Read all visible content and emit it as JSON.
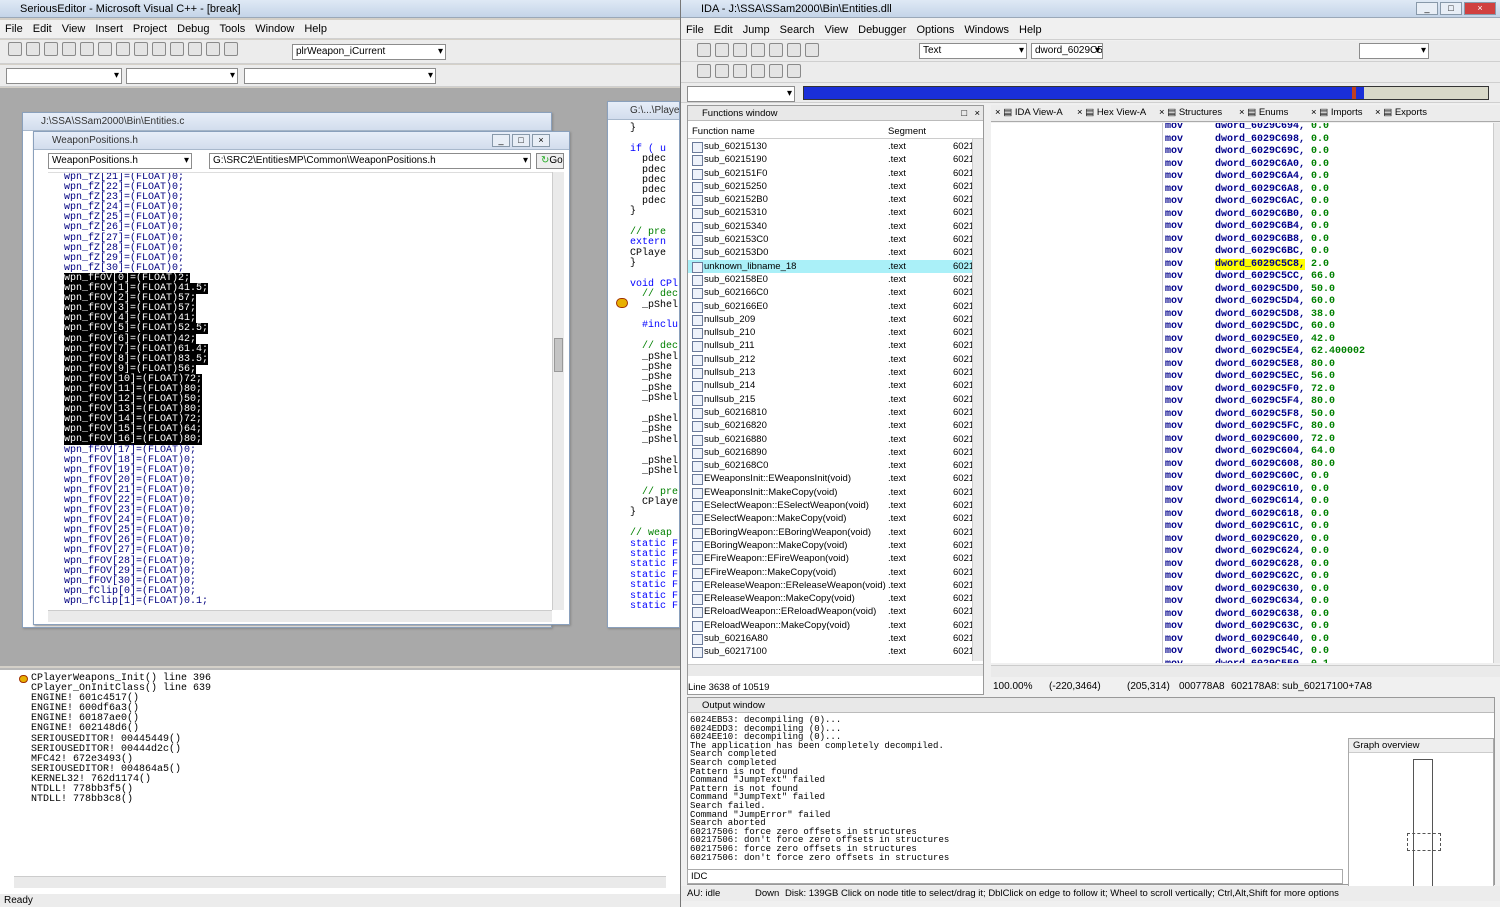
{
  "se": {
    "title": "SeriousEditor - Microsoft Visual C++ - [break]",
    "menu": [
      "File",
      "Edit",
      "View",
      "Insert",
      "Project",
      "Debug",
      "Tools",
      "Window",
      "Help"
    ],
    "combo_func": "plrWeapon_iCurrent",
    "win_entities_title": "J:\\SSA\\SSam2000\\Bin\\Entities.c",
    "win_wp_title": "WeaponPositions.h",
    "wp_combo_file": "WeaponPositions.h",
    "wp_combo_path": "G:\\SRC2\\EntitiesMP\\Common\\WeaponPositions.h",
    "go_label": "Go",
    "code_lines": [
      {
        "t": "wpn_fZ[21]=(FLOAT)0;",
        "s": false
      },
      {
        "t": "wpn_fZ[22]=(FLOAT)0;",
        "s": false
      },
      {
        "t": "wpn_fZ[23]=(FLOAT)0;",
        "s": false
      },
      {
        "t": "wpn_fZ[24]=(FLOAT)0;",
        "s": false
      },
      {
        "t": "wpn_fZ[25]=(FLOAT)0;",
        "s": false
      },
      {
        "t": "wpn_fZ[26]=(FLOAT)0;",
        "s": false
      },
      {
        "t": "wpn_fZ[27]=(FLOAT)0;",
        "s": false
      },
      {
        "t": "wpn_fZ[28]=(FLOAT)0;",
        "s": false
      },
      {
        "t": "wpn_fZ[29]=(FLOAT)0;",
        "s": false
      },
      {
        "t": "wpn_fZ[30]=(FLOAT)0;",
        "s": false
      },
      {
        "t": "wpn_fFOV[0]=(FLOAT)2;",
        "s": true
      },
      {
        "t": "wpn_fFOV[1]=(FLOAT)41.5;",
        "s": true
      },
      {
        "t": "wpn_fFOV[2]=(FLOAT)57;",
        "s": true
      },
      {
        "t": "wpn_fFOV[3]=(FLOAT)57;",
        "s": true
      },
      {
        "t": "wpn_fFOV[4]=(FLOAT)41;",
        "s": true
      },
      {
        "t": "wpn_fFOV[5]=(FLOAT)52.5;",
        "s": true
      },
      {
        "t": "wpn_fFOV[6]=(FLOAT)42;",
        "s": true
      },
      {
        "t": "wpn_fFOV[7]=(FLOAT)61.4;",
        "s": true
      },
      {
        "t": "wpn_fFOV[8]=(FLOAT)83.5;",
        "s": true
      },
      {
        "t": "wpn_fFOV[9]=(FLOAT)56;",
        "s": true
      },
      {
        "t": "wpn_fFOV[10]=(FLOAT)72;",
        "s": true
      },
      {
        "t": "wpn_fFOV[11]=(FLOAT)80;",
        "s": true
      },
      {
        "t": "wpn_fFOV[12]=(FLOAT)50;",
        "s": true
      },
      {
        "t": "wpn_fFOV[13]=(FLOAT)80;",
        "s": true
      },
      {
        "t": "wpn_fFOV[14]=(FLOAT)72;",
        "s": true
      },
      {
        "t": "wpn_fFOV[15]=(FLOAT)64;",
        "s": true
      },
      {
        "t": "wpn_fFOV[16]=(FLOAT)80;",
        "s": true
      },
      {
        "t": "wpn_fFOV[17]=(FLOAT)0;",
        "s": false
      },
      {
        "t": "wpn_fFOV[18]=(FLOAT)0;",
        "s": false
      },
      {
        "t": "wpn_fFOV[19]=(FLOAT)0;",
        "s": false
      },
      {
        "t": "wpn_fFOV[20]=(FLOAT)0;",
        "s": false
      },
      {
        "t": "wpn_fFOV[21]=(FLOAT)0;",
        "s": false
      },
      {
        "t": "wpn_fFOV[22]=(FLOAT)0;",
        "s": false
      },
      {
        "t": "wpn_fFOV[23]=(FLOAT)0;",
        "s": false
      },
      {
        "t": "wpn_fFOV[24]=(FLOAT)0;",
        "s": false
      },
      {
        "t": "wpn_fFOV[25]=(FLOAT)0;",
        "s": false
      },
      {
        "t": "wpn_fFOV[26]=(FLOAT)0;",
        "s": false
      },
      {
        "t": "wpn_fFOV[27]=(FLOAT)0;",
        "s": false
      },
      {
        "t": "wpn_fFOV[28]=(FLOAT)0;",
        "s": false
      },
      {
        "t": "wpn_fFOV[29]=(FLOAT)0;",
        "s": false
      },
      {
        "t": "wpn_fFOV[30]=(FLOAT)0;",
        "s": false
      },
      {
        "t": "wpn_fClip[0]=(FLOAT)0;",
        "s": false
      },
      {
        "t": "wpn_fClip[1]=(FLOAT)0.1;",
        "s": false
      }
    ],
    "win_player_title": "G:\\...\\Player",
    "player_lines": [
      "}",
      "",
      "if ( u",
      "  pdec",
      "  pdec",
      "  pdec",
      "  pdec",
      "  pdec",
      "}",
      "",
      "// pre",
      "extern",
      "CPlaye",
      "}",
      "",
      "void CPl",
      "  // dec",
      "  _pShel",
      "",
      "  #inclu",
      "",
      "  // dec",
      "  _pShel",
      "  _pShe",
      "  _pShe",
      "  _pShe",
      "  _pShel",
      "",
      "  _pShel",
      "  _pShe",
      "  _pShel",
      "",
      "  _pShel",
      "  _pShel",
      "",
      "  // pre",
      "  CPlaye",
      "}",
      "",
      "// weap",
      "static F",
      "static F",
      "static F",
      "static F",
      "static F",
      "static F",
      "static F"
    ],
    "callstack": [
      "CPlayerWeapons_Init() line 396",
      "CPlayer_OnInitClass() line 639",
      "ENGINE! 601c4517()",
      "ENGINE! 600df6a3()",
      "ENGINE! 60187ae0()",
      "ENGINE! 602148d6()",
      "SERIOUSEDITOR! 00445449()",
      "SERIOUSEDITOR! 00444d2c()",
      "MFC42! 672e3493()",
      "SERIOUSEDITOR! 004864a5()",
      "KERNEL32! 762d1174()",
      "NTDLL! 778bb3f5()",
      "NTDLL! 778bb3c8()"
    ],
    "status": "Ready"
  },
  "ida": {
    "title": "IDA - J:\\SSA\\SSam2000\\Bin\\Entities.dll",
    "menu": [
      "File",
      "Edit",
      "Jump",
      "Search",
      "View",
      "Debugger",
      "Options",
      "Windows",
      "Help"
    ],
    "combo_text": "Text",
    "combo_dword": "dword_6029C5",
    "fw_title": "Functions window",
    "col_name": "Function name",
    "col_segment": "Segment",
    "functions": [
      {
        "n": "sub_60215130",
        "s": ".text",
        "a": "6021"
      },
      {
        "n": "sub_60215190",
        "s": ".text",
        "a": "6021"
      },
      {
        "n": "sub_602151F0",
        "s": ".text",
        "a": "6021"
      },
      {
        "n": "sub_60215250",
        "s": ".text",
        "a": "6021"
      },
      {
        "n": "sub_602152B0",
        "s": ".text",
        "a": "6021"
      },
      {
        "n": "sub_60215310",
        "s": ".text",
        "a": "6021"
      },
      {
        "n": "sub_60215340",
        "s": ".text",
        "a": "6021"
      },
      {
        "n": "sub_602153C0",
        "s": ".text",
        "a": "6021"
      },
      {
        "n": "sub_602153D0",
        "s": ".text",
        "a": "6021"
      },
      {
        "n": "unknown_libname_18",
        "s": ".text",
        "a": "6021",
        "h": true
      },
      {
        "n": "sub_602158E0",
        "s": ".text",
        "a": "6021"
      },
      {
        "n": "sub_602166C0",
        "s": ".text",
        "a": "6021"
      },
      {
        "n": "sub_602166E0",
        "s": ".text",
        "a": "6021"
      },
      {
        "n": "nullsub_209",
        "s": ".text",
        "a": "6021"
      },
      {
        "n": "nullsub_210",
        "s": ".text",
        "a": "6021"
      },
      {
        "n": "nullsub_211",
        "s": ".text",
        "a": "6021"
      },
      {
        "n": "nullsub_212",
        "s": ".text",
        "a": "6021"
      },
      {
        "n": "nullsub_213",
        "s": ".text",
        "a": "6021"
      },
      {
        "n": "nullsub_214",
        "s": ".text",
        "a": "6021"
      },
      {
        "n": "nullsub_215",
        "s": ".text",
        "a": "6021"
      },
      {
        "n": "sub_60216810",
        "s": ".text",
        "a": "6021"
      },
      {
        "n": "sub_60216820",
        "s": ".text",
        "a": "6021"
      },
      {
        "n": "sub_60216880",
        "s": ".text",
        "a": "6021"
      },
      {
        "n": "sub_60216890",
        "s": ".text",
        "a": "6021"
      },
      {
        "n": "sub_602168C0",
        "s": ".text",
        "a": "6021"
      },
      {
        "n": "EWeaponsInit::EWeaponsInit(void)",
        "s": ".text",
        "a": "6021"
      },
      {
        "n": "EWeaponsInit::MakeCopy(void)",
        "s": ".text",
        "a": "6021"
      },
      {
        "n": "ESelectWeapon::ESelectWeapon(void)",
        "s": ".text",
        "a": "6021"
      },
      {
        "n": "ESelectWeapon::MakeCopy(void)",
        "s": ".text",
        "a": "6021"
      },
      {
        "n": "EBoringWeapon::EBoringWeapon(void)",
        "s": ".text",
        "a": "6021"
      },
      {
        "n": "EBoringWeapon::MakeCopy(void)",
        "s": ".text",
        "a": "6021"
      },
      {
        "n": "EFireWeapon::EFireWeapon(void)",
        "s": ".text",
        "a": "6021"
      },
      {
        "n": "EFireWeapon::MakeCopy(void)",
        "s": ".text",
        "a": "6021"
      },
      {
        "n": "EReleaseWeapon::EReleaseWeapon(void)",
        "s": ".text",
        "a": "6021"
      },
      {
        "n": "EReleaseWeapon::MakeCopy(void)",
        "s": ".text",
        "a": "6021"
      },
      {
        "n": "EReloadWeapon::EReloadWeapon(void)",
        "s": ".text",
        "a": "6021"
      },
      {
        "n": "EReloadWeapon::MakeCopy(void)",
        "s": ".text",
        "a": "6021"
      },
      {
        "n": "sub_60216A80",
        "s": ".text",
        "a": "6021"
      },
      {
        "n": "sub_60217100",
        "s": ".text",
        "a": "6021"
      }
    ],
    "fw_status": "Line 3638 of 10519",
    "tabs": [
      "IDA View-A",
      "Hex View-A",
      "Structures",
      "Enums",
      "Imports",
      "Exports"
    ],
    "asm": [
      [
        "mov",
        "dword_6029C694,",
        "0.0"
      ],
      [
        "mov",
        "dword_6029C698,",
        "0.0"
      ],
      [
        "mov",
        "dword_6029C69C,",
        "0.0"
      ],
      [
        "mov",
        "dword_6029C6A0,",
        "0.0"
      ],
      [
        "mov",
        "dword_6029C6A4,",
        "0.0"
      ],
      [
        "mov",
        "dword_6029C6A8,",
        "0.0"
      ],
      [
        "mov",
        "dword_6029C6AC,",
        "0.0"
      ],
      [
        "mov",
        "dword_6029C6B0,",
        "0.0"
      ],
      [
        "mov",
        "dword_6029C6B4,",
        "0.0"
      ],
      [
        "mov",
        "dword_6029C6B8,",
        "0.0"
      ],
      [
        "mov",
        "dword_6029C6BC,",
        "0.0"
      ],
      [
        "mov",
        "dword_6029C5C8,",
        "2.0"
      ],
      [
        "mov",
        "dword_6029C5CC,",
        "66.0"
      ],
      [
        "mov",
        "dword_6029C5D0,",
        "50.0"
      ],
      [
        "mov",
        "dword_6029C5D4,",
        "60.0"
      ],
      [
        "mov",
        "dword_6029C5D8,",
        "38.0"
      ],
      [
        "mov",
        "dword_6029C5DC,",
        "60.0"
      ],
      [
        "mov",
        "dword_6029C5E0,",
        "42.0"
      ],
      [
        "mov",
        "dword_6029C5E4,",
        "62.400002"
      ],
      [
        "mov",
        "dword_6029C5E8,",
        "80.0"
      ],
      [
        "mov",
        "dword_6029C5EC,",
        "56.0"
      ],
      [
        "mov",
        "dword_6029C5F0,",
        "72.0"
      ],
      [
        "mov",
        "dword_6029C5F4,",
        "80.0"
      ],
      [
        "mov",
        "dword_6029C5F8,",
        "50.0"
      ],
      [
        "mov",
        "dword_6029C5FC,",
        "80.0"
      ],
      [
        "mov",
        "dword_6029C600,",
        "72.0"
      ],
      [
        "mov",
        "dword_6029C604,",
        "64.0"
      ],
      [
        "mov",
        "dword_6029C608,",
        "80.0"
      ],
      [
        "mov",
        "dword_6029C60C,",
        "0.0"
      ],
      [
        "mov",
        "dword_6029C610,",
        "0.0"
      ],
      [
        "mov",
        "dword_6029C614,",
        "0.0"
      ],
      [
        "mov",
        "dword_6029C618,",
        "0.0"
      ],
      [
        "mov",
        "dword_6029C61C,",
        "0.0"
      ],
      [
        "mov",
        "dword_6029C620,",
        "0.0"
      ],
      [
        "mov",
        "dword_6029C624,",
        "0.0"
      ],
      [
        "mov",
        "dword_6029C628,",
        "0.0"
      ],
      [
        "mov",
        "dword_6029C62C,",
        "0.0"
      ],
      [
        "mov",
        "dword_6029C630,",
        "0.0"
      ],
      [
        "mov",
        "dword_6029C634,",
        "0.0"
      ],
      [
        "mov",
        "dword_6029C638,",
        "0.0"
      ],
      [
        "mov",
        "dword_6029C63C,",
        "0.0"
      ],
      [
        "mov",
        "dword_6029C640,",
        "0.0"
      ],
      [
        "mov",
        "dword_6029C54C,",
        "0.0"
      ],
      [
        "mov",
        "dword_6029C550,",
        "0.1"
      ]
    ],
    "view_status": [
      "100.00%",
      "(-220,3464)",
      "(205,314)",
      "000778A8",
      "602178A8: sub_60217100+7A8"
    ],
    "output_title": "Output window",
    "output": [
      "6024EB53: decompiling (0)...",
      "6024EDD3: decompiling (0)...",
      "6024EE10: decompiling (0)...",
      "The application has been completely decompiled.",
      "Search completed",
      "Search completed",
      "Pattern is not found",
      "Command \"JumpText\" failed",
      "Pattern is not found",
      "Command \"JumpText\" failed",
      "Search failed.",
      "Command \"JumpError\" failed",
      "Search aborted",
      "60217506: force zero offsets in structures",
      "60217506: don't force zero offsets in structures",
      "60217506: force zero offsets in structures",
      "60217506: don't force zero offsets in structures"
    ],
    "idc_label": "IDC",
    "graph_title": "Graph overview",
    "status_au": "AU:  idle",
    "status_down": "Down",
    "status_disk": "Disk: 139GB",
    "status_hint": "Click on node title to select/drag it; DblClick on edge to follow it; Wheel to scroll vertically; Ctrl,Alt,Shift for more options"
  },
  "colors": {
    "highlight": "#aaf0f8",
    "asm": "#00008b",
    "accent": "#0000ff"
  }
}
